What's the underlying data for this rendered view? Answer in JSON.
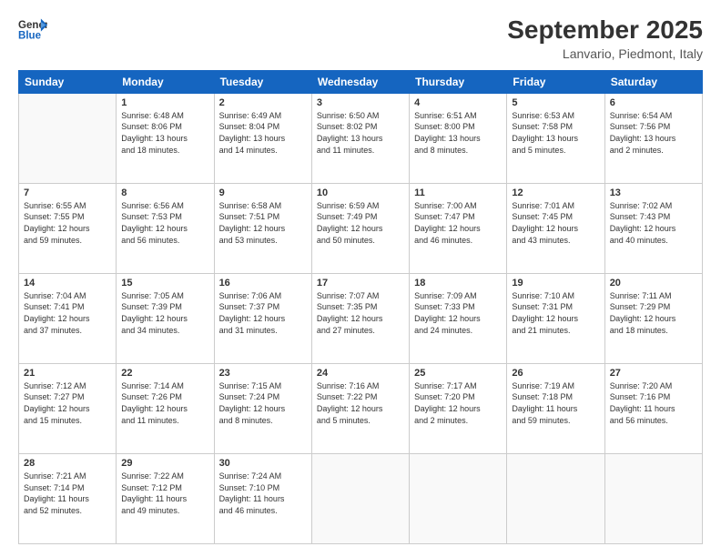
{
  "header": {
    "logo_general": "General",
    "logo_blue": "Blue",
    "month_year": "September 2025",
    "location": "Lanvario, Piedmont, Italy"
  },
  "weekdays": [
    "Sunday",
    "Monday",
    "Tuesday",
    "Wednesday",
    "Thursday",
    "Friday",
    "Saturday"
  ],
  "weeks": [
    [
      {
        "day": "",
        "info": ""
      },
      {
        "day": "1",
        "info": "Sunrise: 6:48 AM\nSunset: 8:06 PM\nDaylight: 13 hours\nand 18 minutes."
      },
      {
        "day": "2",
        "info": "Sunrise: 6:49 AM\nSunset: 8:04 PM\nDaylight: 13 hours\nand 14 minutes."
      },
      {
        "day": "3",
        "info": "Sunrise: 6:50 AM\nSunset: 8:02 PM\nDaylight: 13 hours\nand 11 minutes."
      },
      {
        "day": "4",
        "info": "Sunrise: 6:51 AM\nSunset: 8:00 PM\nDaylight: 13 hours\nand 8 minutes."
      },
      {
        "day": "5",
        "info": "Sunrise: 6:53 AM\nSunset: 7:58 PM\nDaylight: 13 hours\nand 5 minutes."
      },
      {
        "day": "6",
        "info": "Sunrise: 6:54 AM\nSunset: 7:56 PM\nDaylight: 13 hours\nand 2 minutes."
      }
    ],
    [
      {
        "day": "7",
        "info": "Sunrise: 6:55 AM\nSunset: 7:55 PM\nDaylight: 12 hours\nand 59 minutes."
      },
      {
        "day": "8",
        "info": "Sunrise: 6:56 AM\nSunset: 7:53 PM\nDaylight: 12 hours\nand 56 minutes."
      },
      {
        "day": "9",
        "info": "Sunrise: 6:58 AM\nSunset: 7:51 PM\nDaylight: 12 hours\nand 53 minutes."
      },
      {
        "day": "10",
        "info": "Sunrise: 6:59 AM\nSunset: 7:49 PM\nDaylight: 12 hours\nand 50 minutes."
      },
      {
        "day": "11",
        "info": "Sunrise: 7:00 AM\nSunset: 7:47 PM\nDaylight: 12 hours\nand 46 minutes."
      },
      {
        "day": "12",
        "info": "Sunrise: 7:01 AM\nSunset: 7:45 PM\nDaylight: 12 hours\nand 43 minutes."
      },
      {
        "day": "13",
        "info": "Sunrise: 7:02 AM\nSunset: 7:43 PM\nDaylight: 12 hours\nand 40 minutes."
      }
    ],
    [
      {
        "day": "14",
        "info": "Sunrise: 7:04 AM\nSunset: 7:41 PM\nDaylight: 12 hours\nand 37 minutes."
      },
      {
        "day": "15",
        "info": "Sunrise: 7:05 AM\nSunset: 7:39 PM\nDaylight: 12 hours\nand 34 minutes."
      },
      {
        "day": "16",
        "info": "Sunrise: 7:06 AM\nSunset: 7:37 PM\nDaylight: 12 hours\nand 31 minutes."
      },
      {
        "day": "17",
        "info": "Sunrise: 7:07 AM\nSunset: 7:35 PM\nDaylight: 12 hours\nand 27 minutes."
      },
      {
        "day": "18",
        "info": "Sunrise: 7:09 AM\nSunset: 7:33 PM\nDaylight: 12 hours\nand 24 minutes."
      },
      {
        "day": "19",
        "info": "Sunrise: 7:10 AM\nSunset: 7:31 PM\nDaylight: 12 hours\nand 21 minutes."
      },
      {
        "day": "20",
        "info": "Sunrise: 7:11 AM\nSunset: 7:29 PM\nDaylight: 12 hours\nand 18 minutes."
      }
    ],
    [
      {
        "day": "21",
        "info": "Sunrise: 7:12 AM\nSunset: 7:27 PM\nDaylight: 12 hours\nand 15 minutes."
      },
      {
        "day": "22",
        "info": "Sunrise: 7:14 AM\nSunset: 7:26 PM\nDaylight: 12 hours\nand 11 minutes."
      },
      {
        "day": "23",
        "info": "Sunrise: 7:15 AM\nSunset: 7:24 PM\nDaylight: 12 hours\nand 8 minutes."
      },
      {
        "day": "24",
        "info": "Sunrise: 7:16 AM\nSunset: 7:22 PM\nDaylight: 12 hours\nand 5 minutes."
      },
      {
        "day": "25",
        "info": "Sunrise: 7:17 AM\nSunset: 7:20 PM\nDaylight: 12 hours\nand 2 minutes."
      },
      {
        "day": "26",
        "info": "Sunrise: 7:19 AM\nSunset: 7:18 PM\nDaylight: 11 hours\nand 59 minutes."
      },
      {
        "day": "27",
        "info": "Sunrise: 7:20 AM\nSunset: 7:16 PM\nDaylight: 11 hours\nand 56 minutes."
      }
    ],
    [
      {
        "day": "28",
        "info": "Sunrise: 7:21 AM\nSunset: 7:14 PM\nDaylight: 11 hours\nand 52 minutes."
      },
      {
        "day": "29",
        "info": "Sunrise: 7:22 AM\nSunset: 7:12 PM\nDaylight: 11 hours\nand 49 minutes."
      },
      {
        "day": "30",
        "info": "Sunrise: 7:24 AM\nSunset: 7:10 PM\nDaylight: 11 hours\nand 46 minutes."
      },
      {
        "day": "",
        "info": ""
      },
      {
        "day": "",
        "info": ""
      },
      {
        "day": "",
        "info": ""
      },
      {
        "day": "",
        "info": ""
      }
    ]
  ]
}
